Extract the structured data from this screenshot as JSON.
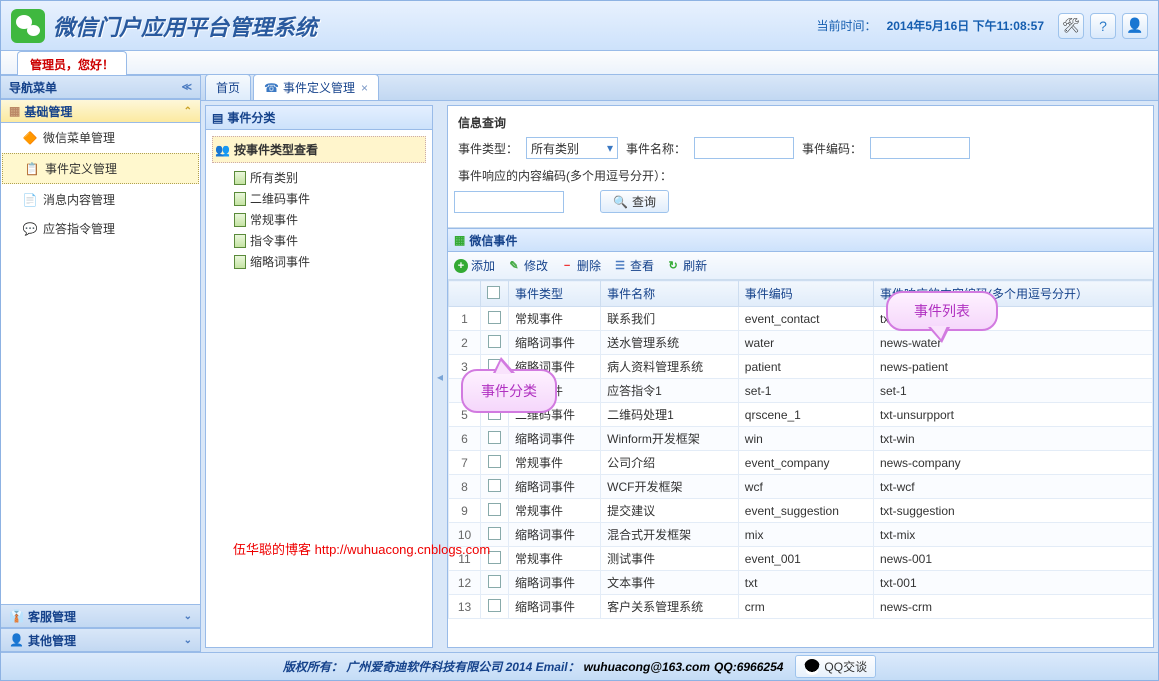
{
  "app_title": "微信门户应用平台管理系统",
  "time_label": "当前时间：",
  "time_value": "2014年5月16日 下午11:08:57",
  "greeting": "管理员，您好！",
  "sidebar": {
    "title": "导航菜单",
    "groups": [
      {
        "label": "基础管理",
        "expanded": true,
        "items": [
          {
            "label": "微信菜单管理",
            "icon": "🔶"
          },
          {
            "label": "事件定义管理",
            "icon": "📋",
            "selected": true
          },
          {
            "label": "消息内容管理",
            "icon": "📄"
          },
          {
            "label": "应答指令管理",
            "icon": "💬"
          }
        ]
      },
      {
        "label": "客服管理",
        "expanded": false
      },
      {
        "label": "其他管理",
        "expanded": false
      }
    ]
  },
  "watermark": "伍华聪的博客 http://wuhuacong.cnblogs.com",
  "tabs": [
    {
      "label": "首页",
      "closable": false
    },
    {
      "label": "事件定义管理",
      "closable": true,
      "active": true,
      "icon": "☎"
    }
  ],
  "tree": {
    "title": "事件分类",
    "root": "按事件类型查看",
    "items": [
      "所有类别",
      "二维码事件",
      "常规事件",
      "指令事件",
      "缩略词事件"
    ]
  },
  "callouts": {
    "tree": "事件分类",
    "list": "事件列表"
  },
  "search": {
    "title": "信息查询",
    "type_label": "事件类型：",
    "type_value": "所有类别",
    "name_label": "事件名称：",
    "code_label": "事件编码：",
    "rescode_label": "事件响应的内容编码(多个用逗号分开）：",
    "btn": "查询"
  },
  "grid": {
    "title": "微信事件",
    "toolbar": {
      "add": "添加",
      "edit": "修改",
      "del": "删除",
      "view": "查看",
      "refresh": "刷新"
    },
    "columns": [
      "事件类型",
      "事件名称",
      "事件编码",
      "事件响应的内容编码(多个用逗号分开）"
    ],
    "rows": [
      [
        "常规事件",
        "联系我们",
        "event_contact",
        "txt-contact"
      ],
      [
        "缩略词事件",
        "送水管理系统",
        "water",
        "news-water"
      ],
      [
        "缩略词事件",
        "病人资料管理系统",
        "patient",
        "news-patient"
      ],
      [
        "指令事件",
        "应答指令1",
        "set-1",
        "set-1"
      ],
      [
        "二维码事件",
        "二维码处理1",
        "qrscene_1",
        "txt-unsurpport"
      ],
      [
        "缩略词事件",
        "Winform开发框架",
        "win",
        "txt-win"
      ],
      [
        "常规事件",
        "公司介绍",
        "event_company",
        "news-company"
      ],
      [
        "缩略词事件",
        "WCF开发框架",
        "wcf",
        "txt-wcf"
      ],
      [
        "常规事件",
        "提交建议",
        "event_suggestion",
        "txt-suggestion"
      ],
      [
        "缩略词事件",
        "混合式开发框架",
        "mix",
        "txt-mix"
      ],
      [
        "常规事件",
        "测试事件",
        "event_001",
        "news-001"
      ],
      [
        "缩略词事件",
        "文本事件",
        "txt",
        "txt-001"
      ],
      [
        "缩略词事件",
        "客户关系管理系统",
        "crm",
        "news-crm"
      ]
    ]
  },
  "footer": {
    "copyright": "版权所有： 广州爱奇迪软件科技有限公司 2014 Email：",
    "email": "wuhuacong@163.com",
    "qq_label": "QQ:6966254",
    "qq_btn": "QQ交谈"
  }
}
